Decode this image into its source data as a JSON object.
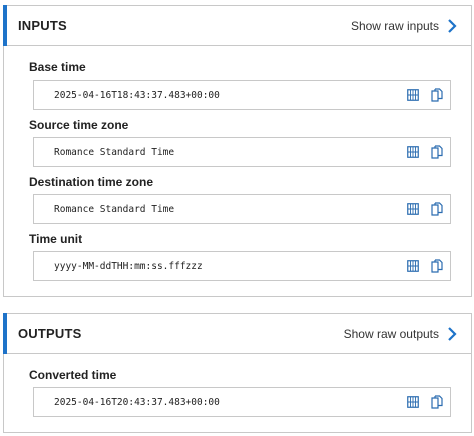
{
  "inputs": {
    "title": "INPUTS",
    "show_raw_label": "Show raw inputs",
    "fields": [
      {
        "label": "Base time",
        "value": "2025-04-16T18:43:37.483+00:00"
      },
      {
        "label": "Source time zone",
        "value": "Romance Standard Time"
      },
      {
        "label": "Destination time zone",
        "value": "Romance Standard Time"
      },
      {
        "label": "Time unit",
        "value": "yyyy-MM-ddTHH:mm:ss.fffzzz"
      }
    ]
  },
  "outputs": {
    "title": "OUTPUTS",
    "show_raw_label": "Show raw outputs",
    "fields": [
      {
        "label": "Converted time",
        "value": "2025-04-16T20:43:37.483+00:00"
      }
    ]
  },
  "colors": {
    "accent": "#1e73c9",
    "icon": "#2b6cb0",
    "border": "#c8c8c8"
  },
  "icons": {
    "expand": "chevron-right-icon",
    "view": "grid-view-icon",
    "copy": "copy-icon"
  }
}
